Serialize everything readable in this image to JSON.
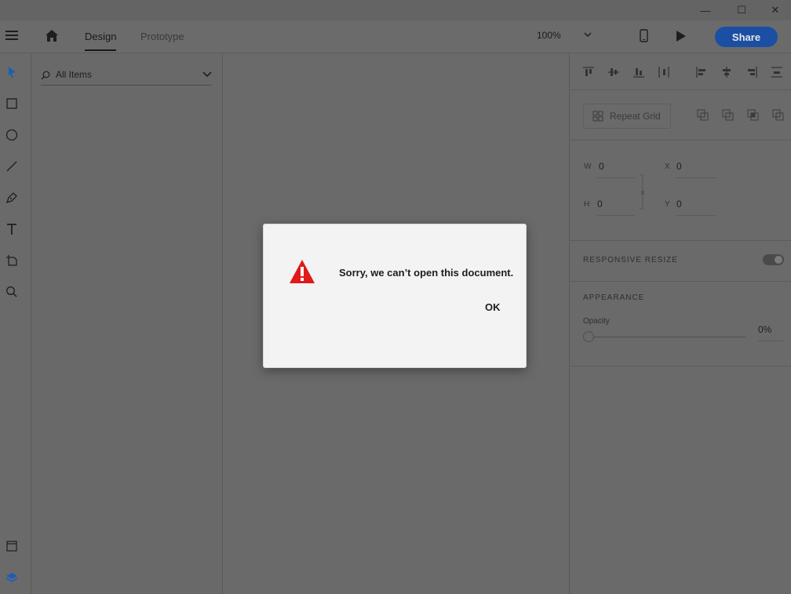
{
  "window": {
    "minimize_symbol": "—",
    "maximize_symbol": "☐",
    "close_symbol": "✕"
  },
  "appbar": {
    "tabs": [
      {
        "label": "Design",
        "active": true
      },
      {
        "label": "Prototype",
        "active": false
      }
    ],
    "zoom": "100%",
    "share_label": "Share"
  },
  "layers": {
    "search_label": "All Items"
  },
  "props": {
    "repeat_grid_label": "Repeat Grid",
    "w_label": "W",
    "w_value": "0",
    "h_label": "H",
    "h_value": "0",
    "x_label": "X",
    "x_value": "0",
    "y_label": "Y",
    "y_value": "0",
    "responsive_resize_label": "RESPONSIVE RESIZE",
    "appearance_label": "APPEARANCE",
    "opacity_label": "Opacity",
    "opacity_value": "0%"
  },
  "dialog": {
    "message": "Sorry, we can’t open this document.",
    "ok_label": "OK"
  },
  "colors": {
    "accent_share": "#1a4fa3",
    "tool_selected": "#1a5fb4",
    "warning_red": "#e0191a"
  }
}
